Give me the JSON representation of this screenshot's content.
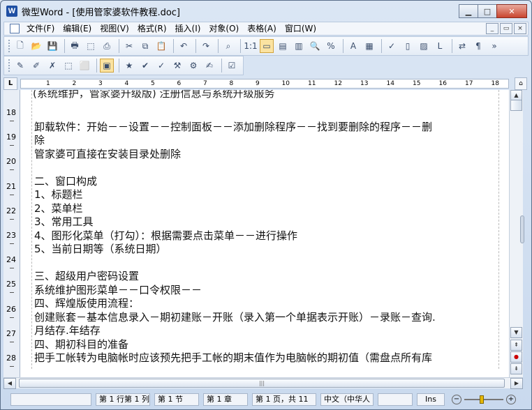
{
  "window": {
    "app_icon_letter": "W",
    "title": "微型Word - [使用管家婆软件教程.doc]",
    "btn_minimize": "▁",
    "btn_maximize": "□",
    "btn_close": "✕"
  },
  "menu": {
    "items": [
      "文件(F)",
      "编辑(E)",
      "视图(V)",
      "格式(R)",
      "插入(I)",
      "对象(O)",
      "表格(A)",
      "窗口(W)"
    ],
    "mdi_minimize": "_",
    "mdi_restore": "▭",
    "mdi_close": "×"
  },
  "toolbar1_icons": [
    "new-icon",
    "open-icon",
    "save-icon",
    "sep",
    "print-icon",
    "pdf-icon",
    "print-preview-icon",
    "sep",
    "cut-icon",
    "copy-icon",
    "paste-icon",
    "sep",
    "undo-icon",
    "sep",
    "redo-icon",
    "sep",
    "find-icon",
    "sep",
    "actual-size-icon",
    "page-width-icon",
    "page-view-icon",
    "two-page-icon",
    "zoom-icon",
    "zoom-percent-icon",
    "sep",
    "text-color-icon",
    "format-icon",
    "sep",
    "spellcheck-icon",
    "columns-icon",
    "shading-icon",
    "line-icon",
    "sep",
    "sync-icon",
    "paragraph-mark-icon",
    "more-icon"
  ],
  "toolbar1_glyphs": {
    "new-icon": "🗋",
    "open-icon": "📂",
    "save-icon": "💾",
    "print-icon": "🖶",
    "pdf-icon": "⬚",
    "print-preview-icon": "⎙",
    "cut-icon": "✂",
    "copy-icon": "⧉",
    "paste-icon": "📋",
    "undo-icon": "↶",
    "redo-icon": "↷",
    "find-icon": "⌕",
    "actual-size-icon": "1:1",
    "page-width-icon": "▭",
    "page-view-icon": "▤",
    "two-page-icon": "▥",
    "zoom-icon": "🔍",
    "zoom-percent-icon": "%",
    "text-color-icon": "A",
    "format-icon": "▦",
    "spellcheck-icon": "✓",
    "columns-icon": "▯",
    "shading-icon": "▨",
    "line-icon": "L",
    "sync-icon": "⇄",
    "paragraph-mark-icon": "¶",
    "more-icon": "»"
  },
  "toolbar2_icons": [
    "track-icon",
    "edit-icon",
    "delete-icon",
    "select-icon",
    "clear-icon",
    "sep",
    "object-icon",
    "sep",
    "star-icon",
    "check-icon",
    "check2-icon",
    "wrench-icon",
    "wrench2-icon",
    "note-icon",
    "sep",
    "approve-icon"
  ],
  "toolbar2_glyphs": {
    "track-icon": "✎",
    "edit-icon": "✐",
    "delete-icon": "✗",
    "select-icon": "⬚",
    "clear-icon": "⬜",
    "object-icon": "▣",
    "star-icon": "★",
    "check-icon": "✔",
    "check2-icon": "✓",
    "wrench-icon": "⚒",
    "wrench2-icon": "⚙",
    "note-icon": "✍",
    "approve-icon": "☑"
  },
  "ruler": {
    "corner": "L",
    "h_numbers": [
      "1",
      "2",
      "3",
      "4",
      "5",
      "6",
      "7",
      "8",
      "9",
      "10",
      "11",
      "12",
      "13",
      "14",
      "15",
      "16",
      "17",
      "18"
    ],
    "v_numbers": [
      "18",
      "19",
      "20",
      "21",
      "22",
      "23",
      "24",
      "25",
      "26",
      "27",
      "28"
    ]
  },
  "document": {
    "partial_top_line": "        (系统维护，管家婆升级版)             注册信息与系统升级服务",
    "lines": [
      "",
      "卸载软件：开始－－设置－－控制面板－－添加删除程序－－找到要删除的程序－－删",
      "除",
      "管家婆可直接在安装目录处删除",
      "",
      "二、窗口构成",
      "1、标题栏",
      "2、菜单栏",
      "3、常用工具",
      "4、图形化菜单（打勾）：根据需要点击菜单－－进行操作",
      "5、当前日期等（系统日期）",
      "",
      "三、超级用户密码设置",
      "系统维护图形菜单－－口令权限－－",
      "四、辉煌版使用流程：",
      "创建账套－基本信息录入－期初建账－开账（录入第一个单据表示开账）－录账－查询.",
      "月结存.年结存",
      "四、期初科目的准备",
      "把手工帐转为电脑帐时应该预先把手工帐的期末值作为电脑帐的期初值（需盘点所有库"
    ]
  },
  "status": {
    "pane1": "",
    "line_col": "第 1 行第 1 列",
    "section": "第 1 节",
    "chapter": "第 1 章",
    "page": "第 1 页，共 11",
    "language": "中文（中华人",
    "mode_blank": "",
    "ins": "Ins",
    "zoom_minus": "−",
    "zoom_plus": "+"
  }
}
